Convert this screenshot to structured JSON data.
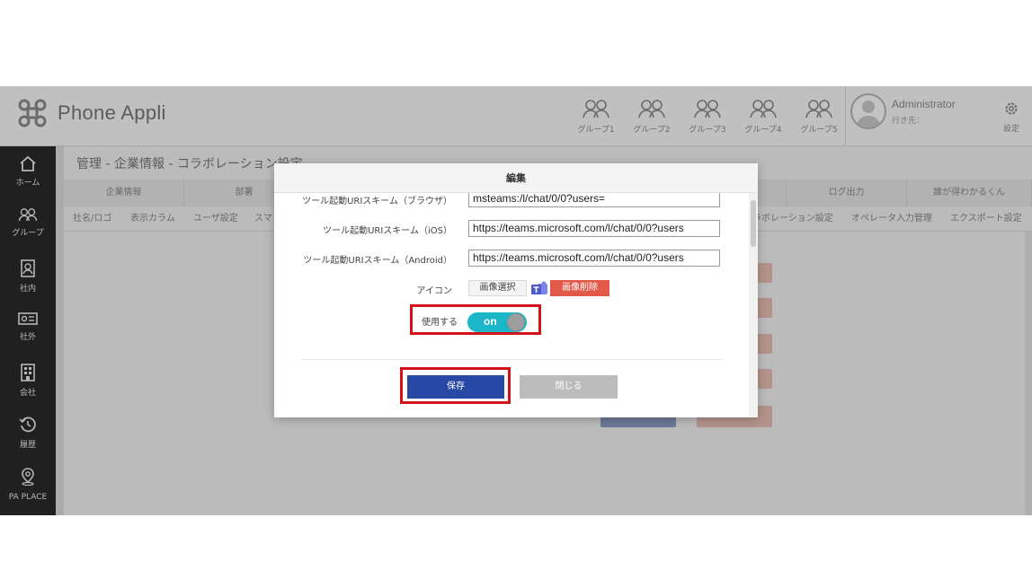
{
  "header": {
    "app_name": "Phone Appli",
    "groups": [
      "グループ1",
      "グループ2",
      "グループ3",
      "グループ4",
      "グループ5"
    ],
    "user_name": "Administrator",
    "user_destination": "行き先：",
    "settings_label": "設定"
  },
  "sidebar": {
    "items": [
      {
        "label": "ホーム",
        "icon": "home-icon"
      },
      {
        "label": "グループ",
        "icon": "group-icon"
      },
      {
        "label": "社内",
        "icon": "internal-icon"
      },
      {
        "label": "社外",
        "icon": "external-icon"
      },
      {
        "label": "会社",
        "icon": "company-icon"
      },
      {
        "label": "履歴",
        "icon": "history-icon"
      },
      {
        "label": "PA PLACE",
        "icon": "place-pin-icon"
      }
    ]
  },
  "page": {
    "breadcrumb": "管理 - 企業情報 - コラボレーション設定",
    "tabs": [
      "企業情報",
      "部署",
      "",
      "",
      "",
      "",
      "ログ出力",
      "誰が得わかるくん"
    ],
    "subtabs_left": [
      "社名/ロゴ",
      "表示カラム",
      "ユーザ設定",
      "スマ"
    ],
    "subtabs_right": [
      "ラボレーション設定",
      "オペレータ入力管理",
      "エクスポート設定"
    ]
  },
  "modal": {
    "title": "編集",
    "fields": [
      {
        "label": "ツール起動URIスキーム（ブラウザ）",
        "value": "msteams:/l/chat/0/0?users="
      },
      {
        "label": "ツール起動URIスキーム（iOS）",
        "value": "https://teams.microsoft.com/l/chat/0/0?users"
      },
      {
        "label": "ツール起動URIスキーム（Android）",
        "value": "https://teams.microsoft.com/l/chat/0/0?users"
      }
    ],
    "icon_label": "アイコン",
    "select_image_label": "画像選択",
    "delete_image_label": "画像削除",
    "use_label": "使用する",
    "toggle_text": "on",
    "save_label": "保存",
    "close_label": "閉じる"
  },
  "colors": {
    "save": "#2848a6",
    "delete": "#e2594a",
    "toggle": "#1bb6c8",
    "highlight": "#d2111a",
    "teams": "#5059c9"
  }
}
